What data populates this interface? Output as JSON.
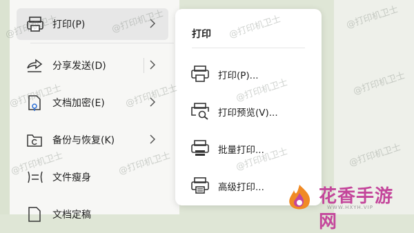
{
  "watermark": "@打印机卫士",
  "menu": {
    "items": [
      {
        "label": "打印(P)"
      },
      {
        "label": "分享发送(D)"
      },
      {
        "label": "文档加密(E)"
      },
      {
        "label": "备份与恢复(K)"
      },
      {
        "label": "文件瘦身"
      },
      {
        "label": "文档定稿"
      }
    ]
  },
  "submenu": {
    "title": "打印",
    "items": [
      {
        "label": "打印(P)..."
      },
      {
        "label": "打印预览(V)..."
      },
      {
        "label": "批量打印..."
      },
      {
        "label": "高级打印..."
      }
    ]
  },
  "brand": {
    "name": "花香手游网",
    "url": "WWW.HXYH.VIP",
    "colors": {
      "pink": "#c4469b",
      "orange": "#f08a24"
    }
  }
}
